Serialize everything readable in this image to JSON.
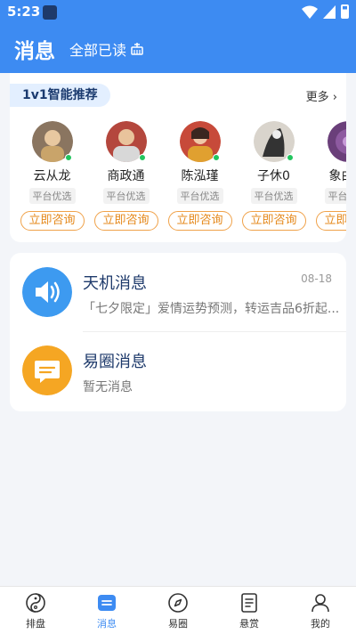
{
  "status_bar": {
    "time": "5:23"
  },
  "header": {
    "title": "消息",
    "read_all": "全部已读"
  },
  "recommend": {
    "tag": "1v1智能推荐",
    "more": "更多",
    "experts": [
      {
        "name": "云从龙",
        "badge": "平台优选",
        "action": "立即咨询"
      },
      {
        "name": "商政通",
        "badge": "平台优选",
        "action": "立即咨询"
      },
      {
        "name": "陈泓瑾",
        "badge": "平台优选",
        "action": "立即咨询"
      },
      {
        "name": "子休0",
        "badge": "平台优选",
        "action": "立即咨询"
      },
      {
        "name": "象由心",
        "badge": "平台优选",
        "action": "立即咨询"
      }
    ]
  },
  "messages": [
    {
      "title": "天机消息",
      "time": "08-18",
      "preview": "「七夕限定」爱情运势预测，转运吉品6折起...",
      "color": "#3d9af0"
    },
    {
      "title": "易圈消息",
      "time": "",
      "preview": "暂无消息",
      "color": "#f5a623"
    }
  ],
  "bottom_nav": [
    {
      "label": "排盘",
      "icon": "yin-yang-icon",
      "active": false
    },
    {
      "label": "消息",
      "icon": "message-icon",
      "active": true
    },
    {
      "label": "易圈",
      "icon": "compass-icon",
      "active": false
    },
    {
      "label": "悬赏",
      "icon": "document-icon",
      "active": false
    },
    {
      "label": "我的",
      "icon": "user-icon",
      "active": false
    }
  ]
}
